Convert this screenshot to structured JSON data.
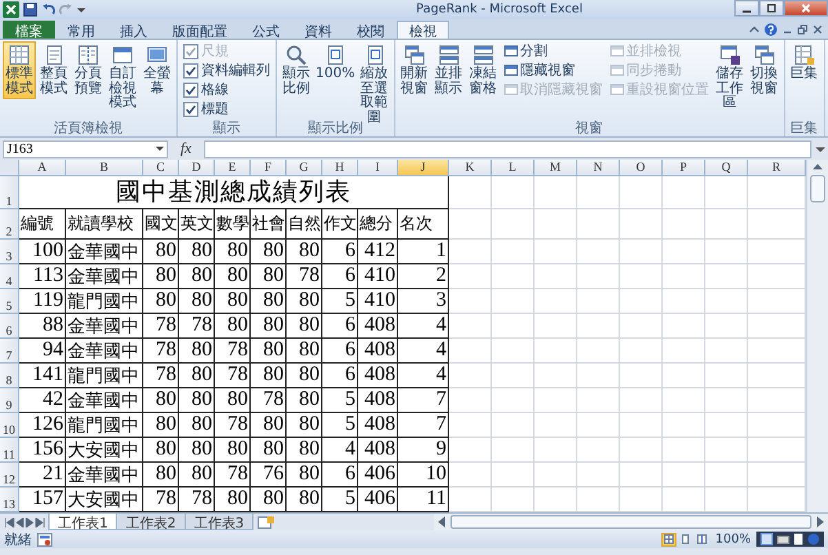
{
  "window": {
    "title": "PageRank - Microsoft Excel"
  },
  "ribbon": {
    "tabs": [
      {
        "label": "檔案",
        "kind": "file",
        "selected": false
      },
      {
        "label": "常用",
        "kind": "tab",
        "selected": false
      },
      {
        "label": "插入",
        "kind": "tab",
        "selected": false
      },
      {
        "label": "版面配置",
        "kind": "tab",
        "selected": false
      },
      {
        "label": "公式",
        "kind": "tab",
        "selected": false
      },
      {
        "label": "資料",
        "kind": "tab",
        "selected": false
      },
      {
        "label": "校閱",
        "kind": "tab",
        "selected": false
      },
      {
        "label": "檢視",
        "kind": "tab",
        "selected": true
      }
    ],
    "groups": [
      {
        "label": "活頁簿檢視",
        "items": [
          {
            "kind": "large",
            "label": "標準模式",
            "selected": true
          },
          {
            "kind": "large",
            "label": "整頁模式",
            "selected": false
          },
          {
            "kind": "large",
            "label": "分頁預覽",
            "selected": false
          },
          {
            "kind": "large",
            "label": "自訂檢視模式"
          },
          {
            "kind": "large",
            "label": "全螢幕"
          }
        ]
      },
      {
        "label": "顯示",
        "items": [
          {
            "kind": "checkbox",
            "label": "尺規",
            "checked": true,
            "disabled": true
          },
          {
            "kind": "checkbox",
            "label": "資料編輯列",
            "checked": true,
            "disabled": false
          },
          {
            "kind": "checkbox",
            "label": "格線",
            "checked": true,
            "disabled": false
          },
          {
            "kind": "checkbox",
            "label": "標題",
            "checked": true,
            "disabled": false
          }
        ]
      },
      {
        "label": "顯示比例",
        "items": [
          {
            "kind": "large",
            "label": "顯示比例"
          },
          {
            "kind": "large",
            "label": "100%"
          },
          {
            "kind": "large",
            "label": "縮放至選取範圍"
          }
        ]
      },
      {
        "label": "視窗",
        "items": [
          {
            "kind": "large",
            "label": "開新視窗"
          },
          {
            "kind": "large",
            "label": "並排顯示"
          },
          {
            "kind": "large",
            "label": "凍結窗格"
          },
          {
            "kind": "small",
            "label": "分割",
            "disabled": false
          },
          {
            "kind": "small",
            "label": "隱藏視窗",
            "disabled": false
          },
          {
            "kind": "small",
            "label": "取消隱藏視窗",
            "disabled": true
          },
          {
            "kind": "small",
            "label": "並排檢視",
            "disabled": true
          },
          {
            "kind": "small",
            "label": "同步捲動",
            "disabled": true
          },
          {
            "kind": "small",
            "label": "重設視窗位置",
            "disabled": true
          },
          {
            "kind": "large",
            "label": "儲存工作區"
          },
          {
            "kind": "large",
            "label": "切換視窗"
          }
        ]
      },
      {
        "label": "巨集",
        "items": [
          {
            "kind": "large",
            "label": "巨集"
          }
        ]
      }
    ]
  },
  "formula_bar": {
    "name_box": "J163",
    "fx": "fx"
  },
  "sheet": {
    "columns": [
      {
        "label": "A",
        "selected": false
      },
      {
        "label": "B",
        "selected": false
      },
      {
        "label": "C",
        "selected": false
      },
      {
        "label": "D",
        "selected": false
      },
      {
        "label": "E",
        "selected": false
      },
      {
        "label": "F",
        "selected": false
      },
      {
        "label": "G",
        "selected": false
      },
      {
        "label": "H",
        "selected": false
      },
      {
        "label": "I",
        "selected": false
      },
      {
        "label": "J",
        "selected": true
      },
      {
        "label": "K",
        "selected": false
      },
      {
        "label": "L",
        "selected": false
      },
      {
        "label": "M",
        "selected": false
      },
      {
        "label": "N",
        "selected": false
      },
      {
        "label": "O",
        "selected": false
      },
      {
        "label": "P",
        "selected": false
      },
      {
        "label": "Q",
        "selected": false
      },
      {
        "label": "R",
        "selected": false
      }
    ],
    "row_headers": [
      "1",
      "2",
      "3",
      "4",
      "5",
      "6",
      "7",
      "8",
      "9",
      "10",
      "11",
      "12",
      "13"
    ],
    "title": "國中基測總成績列表",
    "header": [
      "編號",
      "就讀學校",
      "國文",
      "英文",
      "數學",
      "社會",
      "自然",
      "作文",
      "總分",
      "名次"
    ],
    "rows": [
      [
        "100",
        "金華國中",
        "80",
        "80",
        "80",
        "80",
        "80",
        "6",
        "412",
        "1"
      ],
      [
        "113",
        "金華國中",
        "80",
        "80",
        "80",
        "80",
        "78",
        "6",
        "410",
        "2"
      ],
      [
        "119",
        "龍門國中",
        "80",
        "80",
        "80",
        "80",
        "80",
        "5",
        "410",
        "3"
      ],
      [
        "88",
        "金華國中",
        "78",
        "78",
        "80",
        "80",
        "80",
        "6",
        "408",
        "4"
      ],
      [
        "94",
        "金華國中",
        "78",
        "80",
        "78",
        "80",
        "80",
        "6",
        "408",
        "4"
      ],
      [
        "141",
        "龍門國中",
        "78",
        "80",
        "78",
        "80",
        "80",
        "6",
        "408",
        "4"
      ],
      [
        "42",
        "金華國中",
        "80",
        "80",
        "80",
        "78",
        "80",
        "5",
        "408",
        "7"
      ],
      [
        "126",
        "龍門國中",
        "80",
        "80",
        "78",
        "80",
        "80",
        "5",
        "408",
        "7"
      ],
      [
        "156",
        "大安國中",
        "80",
        "80",
        "80",
        "80",
        "80",
        "4",
        "408",
        "9"
      ],
      [
        "21",
        "金華國中",
        "80",
        "80",
        "78",
        "76",
        "80",
        "6",
        "406",
        "10"
      ],
      [
        "157",
        "大安國中",
        "78",
        "78",
        "80",
        "80",
        "80",
        "5",
        "406",
        "11"
      ]
    ]
  },
  "sheet_tabs": [
    {
      "label": "工作表1",
      "selected": true
    },
    {
      "label": "工作表2",
      "selected": false
    },
    {
      "label": "工作表3",
      "selected": false
    }
  ],
  "status_bar": {
    "status": "就緒",
    "view_buttons": [
      {
        "selected": true
      },
      {
        "selected": false
      },
      {
        "selected": false
      }
    ],
    "zoom": "100%"
  }
}
